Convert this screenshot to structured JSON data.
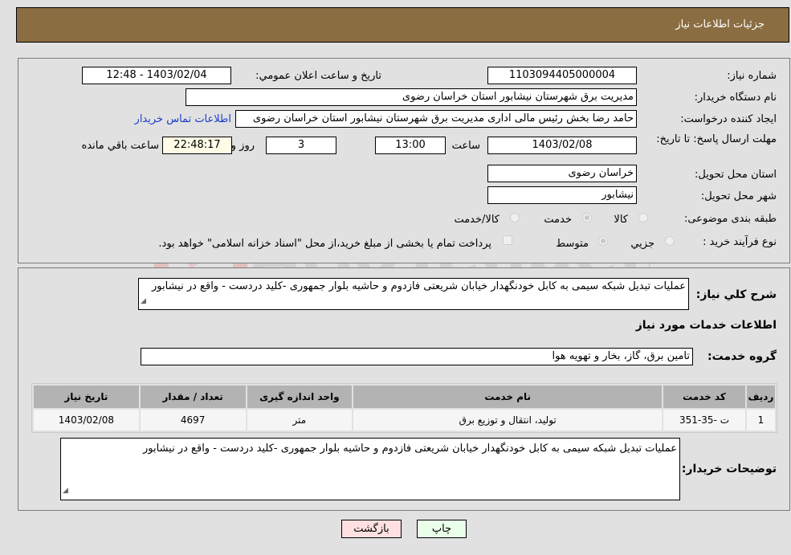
{
  "header": {
    "title": "جزئيات اطلاعات نياز"
  },
  "form": {
    "need_number": {
      "label": "شماره نياز:",
      "value": "1103094405000004"
    },
    "announce_datetime": {
      "label": "تاريخ و ساعت اعلان عمومي:",
      "value": "1403/02/04 - 12:48"
    },
    "buyer_org": {
      "label": "نام دستگاه خريدار:",
      "value": "مديريت برق شهرستان نيشابور استان خراسان رضوی"
    },
    "requester": {
      "label": "ايجاد کننده درخواست:",
      "value": "حامد رضا بخش رئيس مالی اداری مديريت برق شهرستان نيشابور استان خراسان رضوی",
      "contact_link": "اطلاعات تماس خريدار"
    },
    "deadline": {
      "label": "مهلت ارسال پاسخ: تا تاريخ:",
      "date": "1403/02/08",
      "time_label": "ساعت",
      "time": "13:00",
      "days": "3",
      "days_label": "روز و",
      "remaining": "22:48:17",
      "remaining_label": "ساعت باقي مانده"
    },
    "delivery_province": {
      "label": "استان محل تحويل:",
      "value": "خراسان رضوی"
    },
    "delivery_city": {
      "label": "شهر محل تحويل:",
      "value": "نيشابور"
    },
    "category": {
      "label": "طبقه بندی موضوعی:",
      "options": [
        "کالا",
        "خدمت",
        "کالا/خدمت"
      ],
      "selected": "خدمت"
    },
    "purchase_type": {
      "label": "نوع فرآيند خريد :",
      "options": [
        "جزيي",
        "متوسط"
      ],
      "selected": "متوسط",
      "treasury_note": "پرداخت تمام يا بخشی از مبلغ خريد،از محل \"اسناد خزانه اسلامی\" خواهد بود."
    }
  },
  "details": {
    "description": {
      "label": "شرح كلي نياز:",
      "value": "عمليات تبديل شبکه سيمی به کابل خودنگهدار خيابان شريعتی فازدوم و حاشيه بلوار جمهوری -کليد دردست - واقع در نيشابور"
    },
    "section_title": "اطلاعات خدمات مورد نياز",
    "service_group": {
      "label": "گروه خدمت:",
      "value": "تامين برق، گاز، بخار و تهويه هوا"
    },
    "table": {
      "columns": [
        "رديف",
        "کد خدمت",
        "نام خدمت",
        "واحد اندازه گيری",
        "تعداد / مقدار",
        "تاريخ نياز"
      ],
      "rows": [
        [
          "1",
          "ت -35-351",
          "توليد، انتقال و توزيع برق",
          "متر",
          "4697",
          "1403/02/08"
        ]
      ]
    },
    "buyer_notes": {
      "label": "توضيحات خريدار:",
      "value": "عمليات تبديل شبکه سيمی به کابل خودنگهدار خيابان شريعتی فازدوم و حاشيه بلوار جمهوری -کليد دردست - واقع در نيشابور"
    }
  },
  "buttons": {
    "print": "چاپ",
    "back": "بازگشت"
  },
  "watermark": {
    "text": "AriaTender.neT"
  },
  "colors": {
    "header_bg": "#8b6d42",
    "print_bg": "#eaffea",
    "back_bg": "#ffe0e0",
    "link": "#1a3dcc"
  }
}
